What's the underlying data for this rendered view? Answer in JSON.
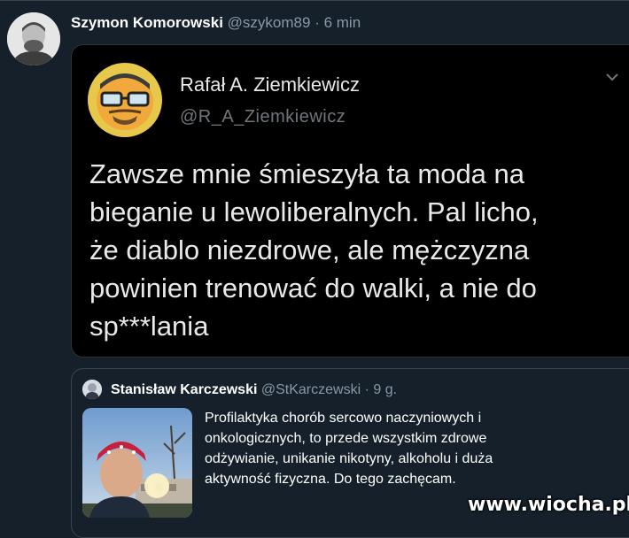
{
  "tweet": {
    "author_name": "Szymon Komorowski",
    "author_handle": "@szykom89",
    "separator": "·",
    "time": "6 min",
    "avatar_icon": "user-avatar-photo"
  },
  "screenshot": {
    "author_name": "Rafał A. Ziemkiewicz",
    "author_handle": "@R_A_Ziemkiewicz",
    "avatar_icon": "cartoon-avatar-glasses",
    "chevron_icon": "chevron-down-icon",
    "lines": [
      "Zawsze mnie śmieszyła ta moda na",
      "bieganie u lewoliberalnych. Pal licho,",
      "że diablo niezdrowe, ale mężczyzna",
      "powinien trenować do walki, a nie do",
      "sp***lania"
    ]
  },
  "quote": {
    "author_name": "Stanisław Karczewski",
    "author_handle": "@StKarczewski",
    "separator": "·",
    "time": "9 g.",
    "media_icon": "photo-runner-red-cap",
    "lines": [
      "Profilaktyka chorób sercowo naczyniowych i",
      "onkologicznych, to przede wszystkim zdrowe",
      "odżywianie, unikanie nikotyny, alkoholu i duża",
      "aktywność fizyczna. Do tego zachęcam."
    ]
  },
  "watermark": "www.wiocha.pl",
  "colors": {
    "background": "#15202b",
    "card_background": "#000000",
    "border": "#38444d",
    "muted_text": "#8899a6",
    "text": "#ffffff"
  }
}
